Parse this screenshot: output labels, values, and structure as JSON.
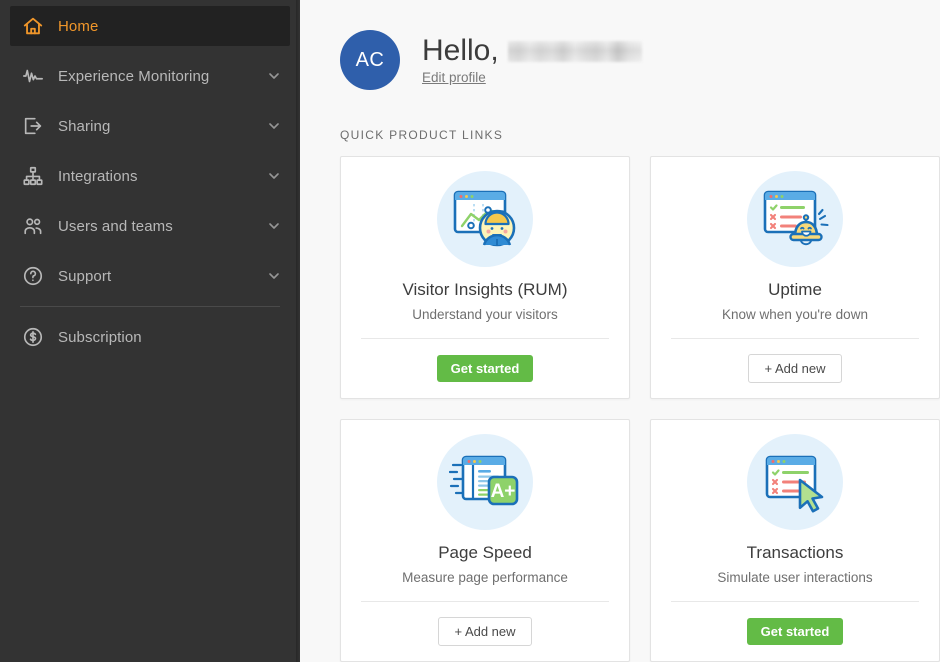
{
  "theme": {
    "sidebar_bg": "#333333",
    "sidebar_active_bg": "#222222",
    "accent_orange": "#f0962a",
    "avatar_blue": "#2f5fab",
    "primary_green": "#63bb46",
    "illustration_circle": "#e3f1fb",
    "page_bg": "#f8f8f8"
  },
  "sidebar": {
    "items": [
      {
        "label": "Home",
        "icon": "home-icon",
        "active": true,
        "expandable": false
      },
      {
        "label": "Experience Monitoring",
        "icon": "pulse-icon",
        "active": false,
        "expandable": true
      },
      {
        "label": "Sharing",
        "icon": "share-box-icon",
        "active": false,
        "expandable": true
      },
      {
        "label": "Integrations",
        "icon": "sitemap-icon",
        "active": false,
        "expandable": true
      },
      {
        "label": "Users and teams",
        "icon": "users-icon",
        "active": false,
        "expandable": true
      },
      {
        "label": "Support",
        "icon": "question-icon",
        "active": false,
        "expandable": true
      },
      {
        "label": "Subscription",
        "icon": "dollar-icon",
        "active": false,
        "expandable": false
      }
    ],
    "chevron_icon": "chevron-down-icon"
  },
  "header": {
    "avatar_initials": "AC",
    "greeting": "Hello,",
    "user_name": "",
    "user_name_redacted": true,
    "edit_profile_label": "Edit profile"
  },
  "main": {
    "section_label": "QUICK PRODUCT LINKS",
    "cards": [
      {
        "title": "Visitor Insights (RUM)",
        "subtitle": "Understand your visitors",
        "illustration": "browser-chart-visitor-icon",
        "button_label": "Get started",
        "button_style": "primary"
      },
      {
        "title": "Uptime",
        "subtitle": "Know when you're down",
        "illustration": "browser-checklist-bell-icon",
        "button_label": "+ Add new",
        "button_style": "secondary"
      },
      {
        "title": "Page Speed",
        "subtitle": "Measure page performance",
        "illustration": "browser-speed-aplus-icon",
        "button_label": "+ Add new",
        "button_style": "secondary"
      },
      {
        "title": "Transactions",
        "subtitle": "Simulate user interactions",
        "illustration": "browser-checklist-cursor-icon",
        "button_label": "Get started",
        "button_style": "primary"
      }
    ]
  }
}
